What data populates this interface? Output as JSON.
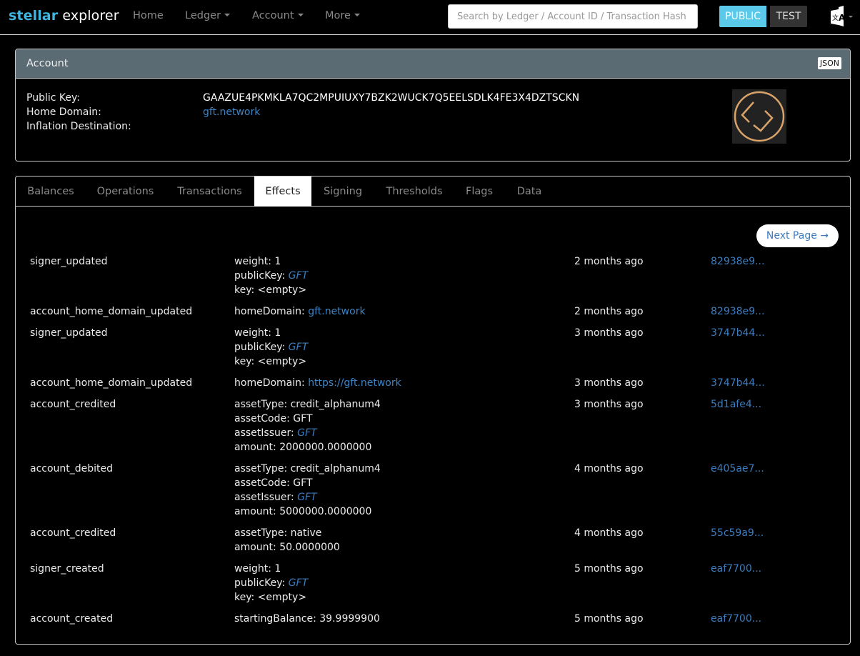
{
  "navbar": {
    "brand_part1": "stellar",
    "brand_part2": "explorer",
    "items": [
      {
        "label": "Home",
        "dropdown": false
      },
      {
        "label": "Ledger",
        "dropdown": true
      },
      {
        "label": "Account",
        "dropdown": true
      },
      {
        "label": "More",
        "dropdown": true
      }
    ],
    "search_placeholder": "Search by Ledger / Account ID / Transaction Hash",
    "search_value": "",
    "network_public": "PUBLIC",
    "network_test": "TEST",
    "language_icon": "translate-icon",
    "colors": {
      "brand_accent": "#3fb6e0",
      "public_button": "#5bc9ea"
    }
  },
  "account": {
    "title": "Account",
    "json_label": "JSON",
    "fields": [
      {
        "label": "Public Key:",
        "value": "GAAZUE4PKMKLA7QC2MPUIUXY7BZK2WUCK7Q5EELSDLK4FE3X4DZTSCKN",
        "is_link": false
      },
      {
        "label": "Home Domain:",
        "value": "gft.network",
        "is_link": true
      },
      {
        "label": "Inflation Destination:",
        "value": "",
        "is_link": false
      }
    ],
    "avatar_icon": "account-logo-icon"
  },
  "tabs": {
    "items": [
      "Balances",
      "Operations",
      "Transactions",
      "Effects",
      "Signing",
      "Thresholds",
      "Flags",
      "Data"
    ],
    "active": "Effects"
  },
  "effects": {
    "next_page_label": "Next Page →",
    "rows": [
      {
        "type": "signer_updated",
        "details": [
          {
            "key": "weight",
            "value": "1",
            "style": "plain"
          },
          {
            "key": "publicKey",
            "value": "GFT",
            "style": "em"
          },
          {
            "key": "key",
            "value": "<empty>",
            "style": "plain"
          }
        ],
        "time": "2 months ago",
        "hash": "82938e9..."
      },
      {
        "type": "account_home_domain_updated",
        "details": [
          {
            "key": "homeDomain",
            "value": "gft.network",
            "style": "link"
          }
        ],
        "time": "2 months ago",
        "hash": "82938e9..."
      },
      {
        "type": "signer_updated",
        "details": [
          {
            "key": "weight",
            "value": "1",
            "style": "plain"
          },
          {
            "key": "publicKey",
            "value": "GFT",
            "style": "em"
          },
          {
            "key": "key",
            "value": "<empty>",
            "style": "plain"
          }
        ],
        "time": "3 months ago",
        "hash": "3747b44..."
      },
      {
        "type": "account_home_domain_updated",
        "details": [
          {
            "key": "homeDomain",
            "value": "https://gft.network",
            "style": "link"
          }
        ],
        "time": "3 months ago",
        "hash": "3747b44..."
      },
      {
        "type": "account_credited",
        "details": [
          {
            "key": "assetType",
            "value": "credit_alphanum4",
            "style": "plain"
          },
          {
            "key": "assetCode",
            "value": "GFT",
            "style": "plain"
          },
          {
            "key": "assetIssuer",
            "value": "GFT",
            "style": "em"
          },
          {
            "key": "amount",
            "value": "2000000.0000000",
            "style": "plain"
          }
        ],
        "time": "3 months ago",
        "hash": "5d1afe4..."
      },
      {
        "type": "account_debited",
        "details": [
          {
            "key": "assetType",
            "value": "credit_alphanum4",
            "style": "plain"
          },
          {
            "key": "assetCode",
            "value": "GFT",
            "style": "plain"
          },
          {
            "key": "assetIssuer",
            "value": "GFT",
            "style": "em"
          },
          {
            "key": "amount",
            "value": "5000000.0000000",
            "style": "plain"
          }
        ],
        "time": "4 months ago",
        "hash": "e405ae7..."
      },
      {
        "type": "account_credited",
        "details": [
          {
            "key": "assetType",
            "value": "native",
            "style": "plain"
          },
          {
            "key": "amount",
            "value": "50.0000000",
            "style": "plain"
          }
        ],
        "time": "4 months ago",
        "hash": "55c59a9..."
      },
      {
        "type": "signer_created",
        "details": [
          {
            "key": "weight",
            "value": "1",
            "style": "plain"
          },
          {
            "key": "publicKey",
            "value": "GFT",
            "style": "em"
          },
          {
            "key": "key",
            "value": "<empty>",
            "style": "plain"
          }
        ],
        "time": "5 months ago",
        "hash": "eaf7700..."
      },
      {
        "type": "account_created",
        "details": [
          {
            "key": "startingBalance",
            "value": "39.9999900",
            "style": "plain"
          }
        ],
        "time": "5 months ago",
        "hash": "eaf7700..."
      }
    ],
    "colors": {
      "link": "#3c7dbf"
    }
  }
}
